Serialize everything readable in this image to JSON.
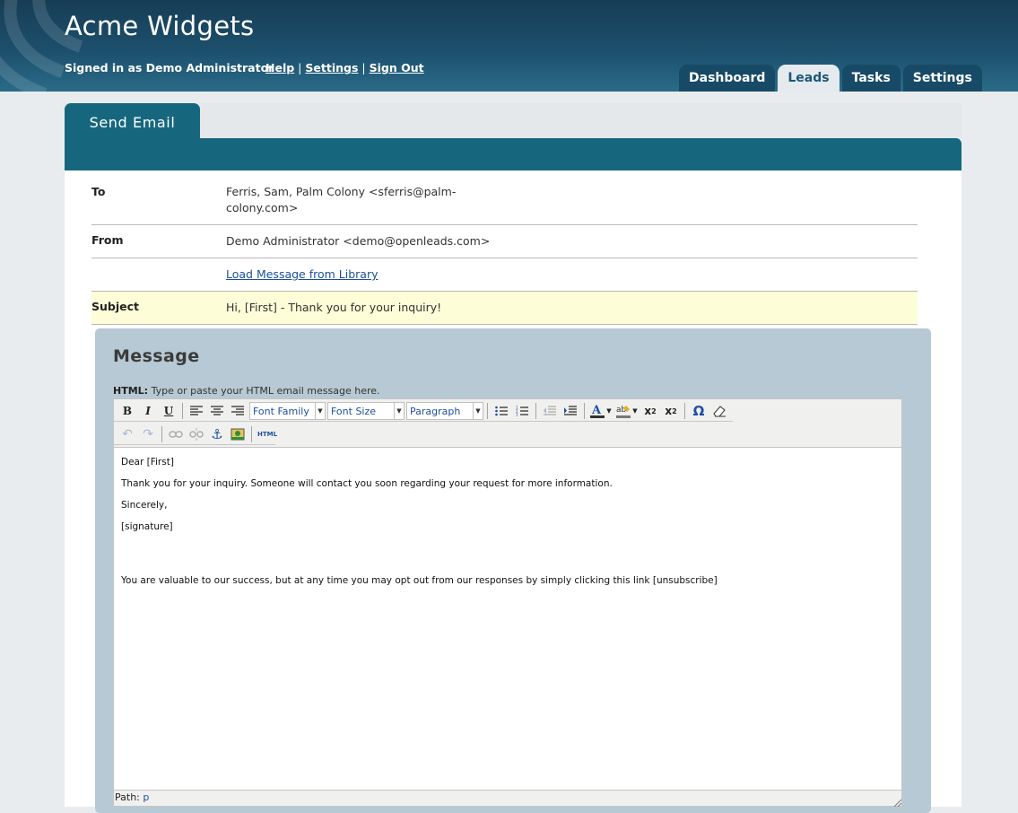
{
  "app": {
    "title": "Acme Widgets",
    "signed_in": "Signed in as Demo Administrator",
    "links": {
      "help": "Help",
      "settings": "Settings",
      "sign_out": "Sign Out",
      "separator": "|"
    },
    "nav_tabs": [
      {
        "label": "Dashboard",
        "active": false
      },
      {
        "label": "Leads",
        "active": true
      },
      {
        "label": "Tasks",
        "active": false
      },
      {
        "label": "Settings",
        "active": false
      }
    ]
  },
  "page": {
    "tab_label": "Send Email"
  },
  "form": {
    "to_label": "To",
    "to_value": "Ferris, Sam, Palm Colony <sferris@palm-colony.com>",
    "from_label": "From",
    "from_value": "Demo Administrator <demo@openleads.com>",
    "library_link": "Load Message from Library",
    "subject_label": "Subject",
    "subject_value": "Hi, [First] - Thank you for your inquiry!"
  },
  "message": {
    "title": "Message",
    "hint_bold": "HTML:",
    "hint_text": " Type or paste your HTML email message here.",
    "toolbar": {
      "font_family": "Font Family",
      "font_size": "Font Size",
      "format": "Paragraph",
      "html_button": "HTML"
    },
    "body_lines": [
      "Dear [First]",
      "Thank you for your inquiry. Someone will contact you soon regarding your request for more information.",
      "Sincerely,",
      "[signature]",
      "You are valuable to our success, but at any time you may opt out from our responses by simply clicking this link [unsubscribe]"
    ],
    "status_path_label": "Path:",
    "status_path_value": "p"
  },
  "colors": {
    "header": "#1c4f6c",
    "teal": "#16677e",
    "subject_highlight": "#fdfdd8",
    "message_box": "#b6c9d4",
    "link": "#1a4f9e"
  }
}
